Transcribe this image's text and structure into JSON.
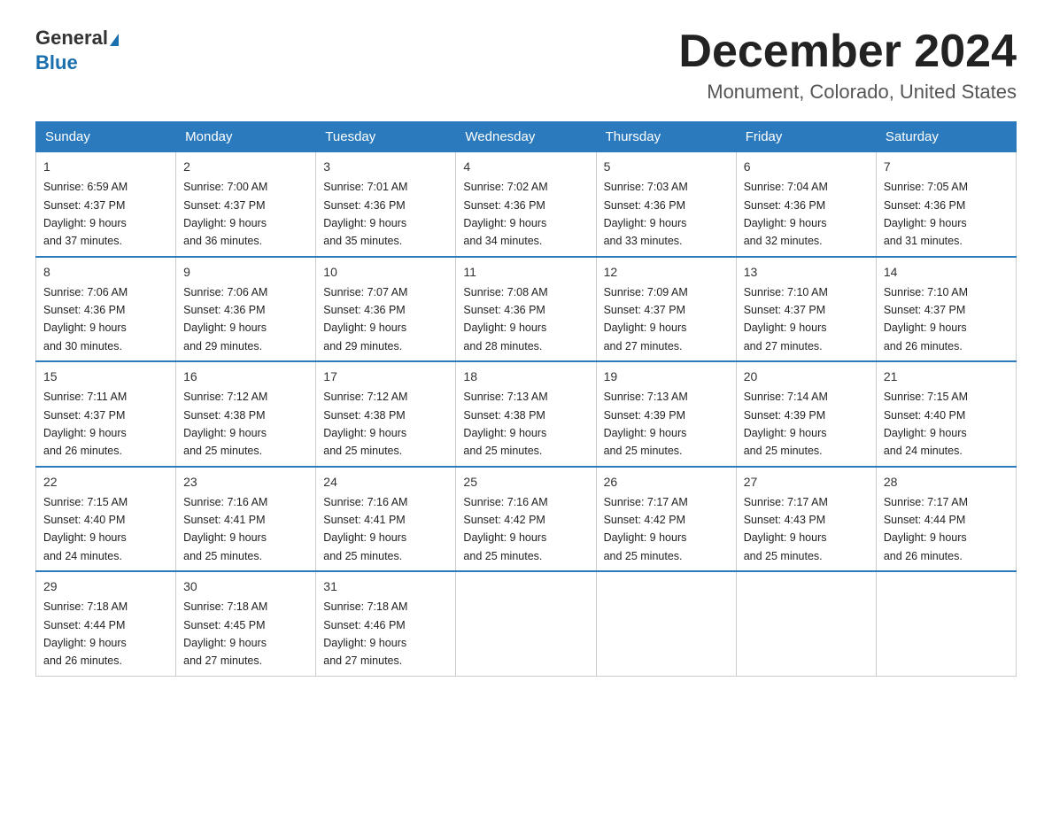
{
  "header": {
    "logo_line1": "General",
    "logo_line2": "Blue",
    "month_title": "December 2024",
    "location": "Monument, Colorado, United States"
  },
  "days_of_week": [
    "Sunday",
    "Monday",
    "Tuesday",
    "Wednesday",
    "Thursday",
    "Friday",
    "Saturday"
  ],
  "weeks": [
    [
      {
        "day": "1",
        "sunrise": "6:59 AM",
        "sunset": "4:37 PM",
        "daylight": "9 hours and 37 minutes."
      },
      {
        "day": "2",
        "sunrise": "7:00 AM",
        "sunset": "4:37 PM",
        "daylight": "9 hours and 36 minutes."
      },
      {
        "day": "3",
        "sunrise": "7:01 AM",
        "sunset": "4:36 PM",
        "daylight": "9 hours and 35 minutes."
      },
      {
        "day": "4",
        "sunrise": "7:02 AM",
        "sunset": "4:36 PM",
        "daylight": "9 hours and 34 minutes."
      },
      {
        "day": "5",
        "sunrise": "7:03 AM",
        "sunset": "4:36 PM",
        "daylight": "9 hours and 33 minutes."
      },
      {
        "day": "6",
        "sunrise": "7:04 AM",
        "sunset": "4:36 PM",
        "daylight": "9 hours and 32 minutes."
      },
      {
        "day": "7",
        "sunrise": "7:05 AM",
        "sunset": "4:36 PM",
        "daylight": "9 hours and 31 minutes."
      }
    ],
    [
      {
        "day": "8",
        "sunrise": "7:06 AM",
        "sunset": "4:36 PM",
        "daylight": "9 hours and 30 minutes."
      },
      {
        "day": "9",
        "sunrise": "7:06 AM",
        "sunset": "4:36 PM",
        "daylight": "9 hours and 29 minutes."
      },
      {
        "day": "10",
        "sunrise": "7:07 AM",
        "sunset": "4:36 PM",
        "daylight": "9 hours and 29 minutes."
      },
      {
        "day": "11",
        "sunrise": "7:08 AM",
        "sunset": "4:36 PM",
        "daylight": "9 hours and 28 minutes."
      },
      {
        "day": "12",
        "sunrise": "7:09 AM",
        "sunset": "4:37 PM",
        "daylight": "9 hours and 27 minutes."
      },
      {
        "day": "13",
        "sunrise": "7:10 AM",
        "sunset": "4:37 PM",
        "daylight": "9 hours and 27 minutes."
      },
      {
        "day": "14",
        "sunrise": "7:10 AM",
        "sunset": "4:37 PM",
        "daylight": "9 hours and 26 minutes."
      }
    ],
    [
      {
        "day": "15",
        "sunrise": "7:11 AM",
        "sunset": "4:37 PM",
        "daylight": "9 hours and 26 minutes."
      },
      {
        "day": "16",
        "sunrise": "7:12 AM",
        "sunset": "4:38 PM",
        "daylight": "9 hours and 25 minutes."
      },
      {
        "day": "17",
        "sunrise": "7:12 AM",
        "sunset": "4:38 PM",
        "daylight": "9 hours and 25 minutes."
      },
      {
        "day": "18",
        "sunrise": "7:13 AM",
        "sunset": "4:38 PM",
        "daylight": "9 hours and 25 minutes."
      },
      {
        "day": "19",
        "sunrise": "7:13 AM",
        "sunset": "4:39 PM",
        "daylight": "9 hours and 25 minutes."
      },
      {
        "day": "20",
        "sunrise": "7:14 AM",
        "sunset": "4:39 PM",
        "daylight": "9 hours and 25 minutes."
      },
      {
        "day": "21",
        "sunrise": "7:15 AM",
        "sunset": "4:40 PM",
        "daylight": "9 hours and 24 minutes."
      }
    ],
    [
      {
        "day": "22",
        "sunrise": "7:15 AM",
        "sunset": "4:40 PM",
        "daylight": "9 hours and 24 minutes."
      },
      {
        "day": "23",
        "sunrise": "7:16 AM",
        "sunset": "4:41 PM",
        "daylight": "9 hours and 25 minutes."
      },
      {
        "day": "24",
        "sunrise": "7:16 AM",
        "sunset": "4:41 PM",
        "daylight": "9 hours and 25 minutes."
      },
      {
        "day": "25",
        "sunrise": "7:16 AM",
        "sunset": "4:42 PM",
        "daylight": "9 hours and 25 minutes."
      },
      {
        "day": "26",
        "sunrise": "7:17 AM",
        "sunset": "4:42 PM",
        "daylight": "9 hours and 25 minutes."
      },
      {
        "day": "27",
        "sunrise": "7:17 AM",
        "sunset": "4:43 PM",
        "daylight": "9 hours and 25 minutes."
      },
      {
        "day": "28",
        "sunrise": "7:17 AM",
        "sunset": "4:44 PM",
        "daylight": "9 hours and 26 minutes."
      }
    ],
    [
      {
        "day": "29",
        "sunrise": "7:18 AM",
        "sunset": "4:44 PM",
        "daylight": "9 hours and 26 minutes."
      },
      {
        "day": "30",
        "sunrise": "7:18 AM",
        "sunset": "4:45 PM",
        "daylight": "9 hours and 27 minutes."
      },
      {
        "day": "31",
        "sunrise": "7:18 AM",
        "sunset": "4:46 PM",
        "daylight": "9 hours and 27 minutes."
      },
      null,
      null,
      null,
      null
    ]
  ],
  "labels": {
    "sunrise": "Sunrise:",
    "sunset": "Sunset:",
    "daylight": "Daylight:"
  }
}
